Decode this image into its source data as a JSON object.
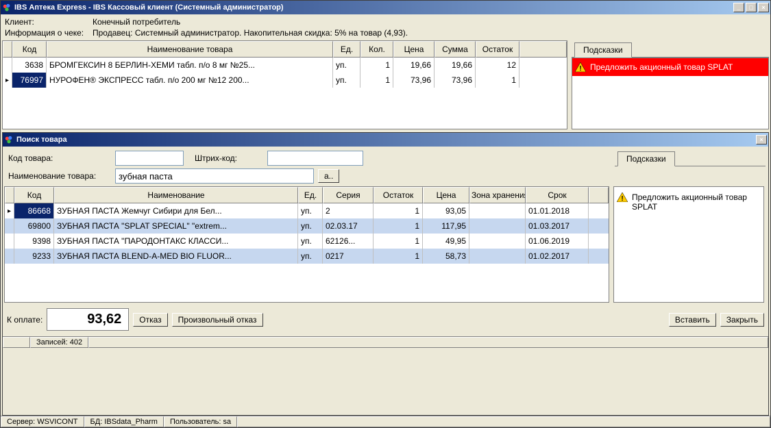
{
  "main": {
    "title": "IBS Аптека Express - IBS Кассовый клиент (Системный администратор)",
    "client_label": "Клиент:",
    "client_value": "Конечный потребитель",
    "info_label": "Информация о чеке:",
    "info_value": "Продавец: Системный администратор. Накопительная скидка: 5% на товар (4,93).",
    "hints_tab": "Подсказки",
    "hint_red": "Предложить акционный товар SPLAT",
    "cols": {
      "code": "Код",
      "name": "Наименование товара",
      "unit": "Ед.",
      "qty": "Кол.",
      "price": "Цена",
      "sum": "Сумма",
      "rest": "Остаток"
    },
    "rows": [
      {
        "code": "3638",
        "name": "БРОМГЕКСИН 8 БЕРЛИН-ХЕМИ табл. п/о 8 мг №25...",
        "unit": "уп.",
        "qty": "1",
        "price": "19,66",
        "sum": "19,66",
        "rest": "12",
        "selected": false,
        "active": false
      },
      {
        "code": "76997",
        "name": "НУРОФЕН® ЭКСПРЕСС табл. п/о 200 мг №12 200...",
        "unit": "уп.",
        "qty": "1",
        "price": "73,96",
        "sum": "73,96",
        "rest": "1",
        "selected": true,
        "active": true
      }
    ]
  },
  "search": {
    "title": "Поиск товара",
    "code_label": "Код товара:",
    "barcode_label": "Штрих-код:",
    "name_label": "Наименование товара:",
    "name_value": "зубная паста",
    "a_btn": "а..",
    "hints_tab": "Подсказки",
    "hint_yellow": "Предложить акционный товар SPLAT",
    "cols": {
      "code": "Код",
      "name": "Наименование",
      "unit": "Ед.",
      "series": "Серия",
      "rest": "Остаток",
      "price": "Цена",
      "zone": "Зона хранения",
      "exp": "Срок"
    },
    "rows": [
      {
        "code": "86668",
        "name": "ЗУБНАЯ ПАСТА  Жемчуг Сибири для Бел...",
        "unit": "уп.",
        "series": "2",
        "rest": "1",
        "price": "93,05",
        "zone": "",
        "exp": "01.01.2018",
        "selected": true,
        "active": true,
        "hl": false
      },
      {
        "code": "69800",
        "name": "ЗУБНАЯ ПАСТА \"SPLAT SPECIAL\" \"extrem...",
        "unit": "уп.",
        "series": "02.03.17",
        "rest": "1",
        "price": "117,95",
        "zone": "",
        "exp": "01.03.2017",
        "selected": false,
        "active": false,
        "hl": true
      },
      {
        "code": "9398",
        "name": "ЗУБНАЯ ПАСТА \"ПАРОДОНТАКС КЛАССИ...",
        "unit": "уп.",
        "series": "62126...",
        "rest": "1",
        "price": "49,95",
        "zone": "",
        "exp": "01.06.2019",
        "selected": false,
        "active": false,
        "hl": false
      },
      {
        "code": "9233",
        "name": "ЗУБНАЯ ПАСТА BLEND-A-MED BIO FLUOR...",
        "unit": "уп.",
        "series": "0217",
        "rest": "1",
        "price": "58,73",
        "zone": "",
        "exp": "01.02.2017",
        "selected": false,
        "active": false,
        "hl": true
      }
    ],
    "total_label": "К оплате:",
    "total_value": "93,62",
    "reject_btn": "Отказ",
    "custom_reject_btn": "Произвольный отказ",
    "insert_btn": "Вставить",
    "close_btn": "Закрыть",
    "records_label": "Записей:  402"
  },
  "status": {
    "server": "Сервер: WSVICONT",
    "db": "БД: IBSdata_Pharm",
    "user": "Пользователь: sa"
  }
}
